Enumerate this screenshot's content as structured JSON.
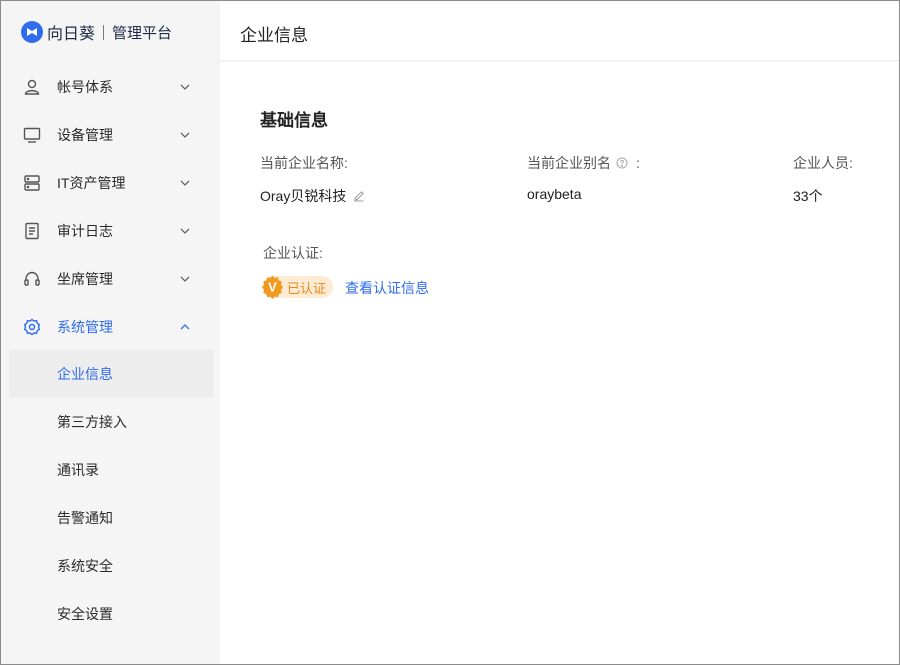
{
  "brand": {
    "name": "向日葵",
    "subtitle": "管理平台"
  },
  "sidebar": {
    "items": [
      {
        "label": "帐号体系",
        "icon": "user-icon"
      },
      {
        "label": "设备管理",
        "icon": "monitor-icon"
      },
      {
        "label": "IT资产管理",
        "icon": "server-icon"
      },
      {
        "label": "审计日志",
        "icon": "document-icon"
      },
      {
        "label": "坐席管理",
        "icon": "headset-icon"
      },
      {
        "label": "系统管理",
        "icon": "gear-icon",
        "expanded": true
      }
    ],
    "sub_items": [
      {
        "label": "企业信息",
        "selected": true
      },
      {
        "label": "第三方接入"
      },
      {
        "label": "通讯录"
      },
      {
        "label": "告警通知"
      },
      {
        "label": "系统安全"
      },
      {
        "label": "安全设置"
      }
    ]
  },
  "header": {
    "title": "企业信息"
  },
  "main": {
    "section_title": "基础信息",
    "fields": [
      {
        "label": "当前企业名称:",
        "value": "Oray贝锐科技"
      },
      {
        "label": "当前企业别名",
        "label_suffix": ":",
        "value": "oraybeta"
      },
      {
        "label": "企业人员:",
        "value": "33个"
      }
    ],
    "certification": {
      "label": "企业认证:",
      "badge": "已认证",
      "badge_mark": "V",
      "link": "查看认证信息"
    }
  },
  "colors": {
    "accent": "#2f6cf0",
    "badge_bg": "#fdecd3",
    "badge_fg": "#e8891a",
    "sidebar_bg": "#f5f5f5"
  }
}
